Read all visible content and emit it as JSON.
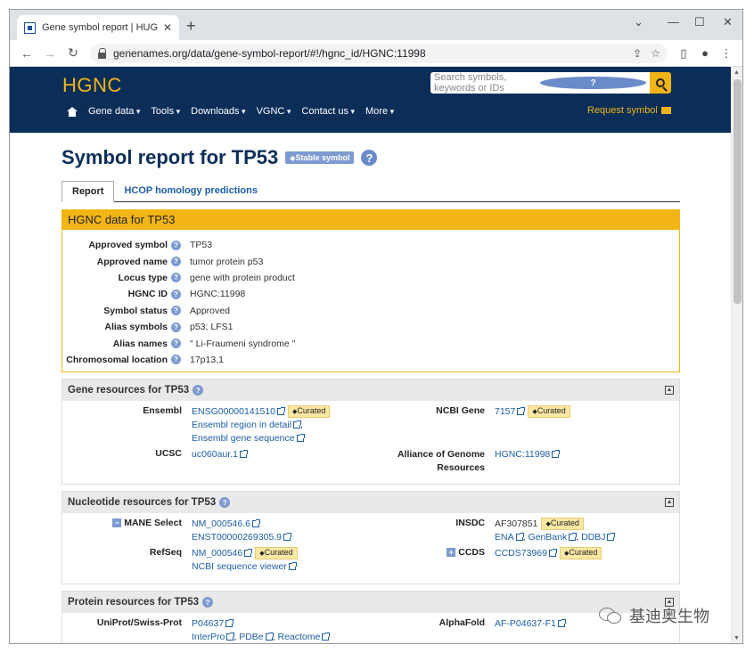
{
  "browser": {
    "tab_title": "Gene symbol report | HUGO G",
    "url": "genenames.org/data/gene-symbol-report/#!/hgnc_id/HGNC:11998"
  },
  "header": {
    "logo": "HGNC",
    "search_placeholder": "Search symbols, keywords or IDs",
    "nav": [
      "Gene data",
      "Tools",
      "Downloads",
      "VGNC",
      "Contact us",
      "More"
    ],
    "request_symbol": "Request symbol"
  },
  "page": {
    "title": "Symbol report for TP53",
    "badge": "Stable symbol",
    "tabs": [
      "Report",
      "HCOP homology predictions"
    ]
  },
  "hgnc_data": {
    "heading": "HGNC data for TP53",
    "rows": [
      {
        "key": "Approved symbol",
        "value": "TP53"
      },
      {
        "key": "Approved name",
        "value": "tumor protein p53"
      },
      {
        "key": "Locus type",
        "value": "gene with protein product"
      },
      {
        "key": "HGNC ID",
        "value": "HGNC:11998"
      },
      {
        "key": "Symbol status",
        "value": "Approved"
      },
      {
        "key": "Alias symbols",
        "value": "p53; LFS1"
      },
      {
        "key": "Alias names",
        "value": "\" Li-Fraumeni syndrome \""
      },
      {
        "key": "Chromosomal location",
        "value": "17p13.1"
      }
    ]
  },
  "gene_resources": {
    "heading": "Gene resources for TP53",
    "ensembl_label": "Ensembl",
    "ensembl_id": "ENSG00000141510",
    "ensembl_region": "Ensembl region in detail",
    "ensembl_sequence": "Ensembl gene sequence",
    "ucsc_label": "UCSC",
    "ucsc_id": "uc060aur.1",
    "ncbi_label": "NCBI Gene",
    "ncbi_id": "7157",
    "alliance_label_1": "Alliance of Genome",
    "alliance_label_2": "Resources",
    "alliance_id": "HGNC:11998",
    "curated": "Curated"
  },
  "nucleotide_resources": {
    "heading": "Nucleotide resources for TP53",
    "mane_label": "MANE Select",
    "mane_nm": "NM_000546.6",
    "mane_enst": "ENST00000269305.9",
    "refseq_label": "RefSeq",
    "refseq_id": "NM_000546",
    "refseq_viewer": "NCBI sequence viewer",
    "insdc_label": "INSDC",
    "insdc_id": "AF307851",
    "ena": "ENA",
    "genbank": "GenBank",
    "ddbj": "DDBJ",
    "ccds_label": "CCDS",
    "ccds_id": "CCDS73969",
    "curated": "Curated"
  },
  "protein_resources": {
    "heading": "Protein resources for TP53",
    "uniprot_label": "UniProt/Swiss-Prot",
    "uniprot_id": "P04637",
    "interpro": "InterPro",
    "pdbe": "PDBe",
    "reactome": "Reactome",
    "alphafold_label": "AlphaFold",
    "alphafold_id": "AF-P04637-F1"
  },
  "watermark": "基迪奥生物"
}
